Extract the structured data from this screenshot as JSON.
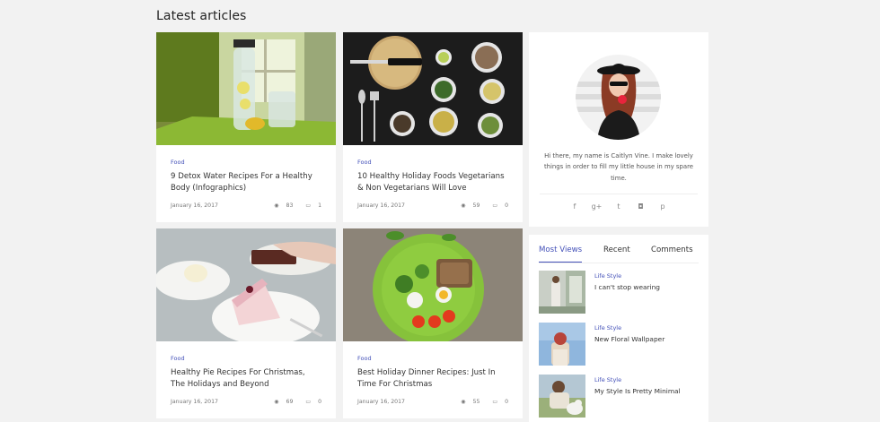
{
  "section_title": "Latest articles",
  "colors": {
    "accent": "#4350b8",
    "background": "#f2f2f2",
    "card": "#ffffff"
  },
  "articles": [
    {
      "category": "Food",
      "title": "9 Detox Water Recipes For a Healthy Body (Infographics)",
      "date": "January 16, 2017",
      "views": "83",
      "comments": "1",
      "image": "detox-water-pitcher-photo"
    },
    {
      "category": "Food",
      "title": "10 Healthy Holiday Foods Vegetarians & Non Vegetarians Will Love",
      "date": "January 16, 2017",
      "views": "59",
      "comments": "0",
      "image": "food-bowls-table-photo"
    },
    {
      "category": "Food",
      "title": "Healthy Pie Recipes For Christmas, The Holidays and Beyond",
      "date": "January 16, 2017",
      "views": "69",
      "comments": "0",
      "image": "cake-slice-plate-photo"
    },
    {
      "category": "Food",
      "title": "Best Holiday Dinner Recipes: Just In Time For Christmas",
      "date": "January 16, 2017",
      "views": "55",
      "comments": "0",
      "image": "salad-green-plate-photo"
    }
  ],
  "profile": {
    "bio": "Hi there, my name is Caitlyn Vine. I make lovely things in order to fill my little house in my spare time.",
    "socials": [
      "f",
      "g+",
      "t",
      "◘",
      "p"
    ],
    "social_names": [
      "facebook-icon",
      "google-plus-icon",
      "twitter-icon",
      "instagram-icon",
      "pinterest-icon"
    ]
  },
  "tabs": {
    "labels": [
      "Most Views",
      "Recent",
      "Comments"
    ],
    "active": 0
  },
  "popular": [
    {
      "category": "Life Style",
      "title": "I can't stop wearing"
    },
    {
      "category": "Life Style",
      "title": "New Floral Wallpaper"
    },
    {
      "category": "Life Style",
      "title": "My Style Is Pretty Minimal"
    }
  ]
}
